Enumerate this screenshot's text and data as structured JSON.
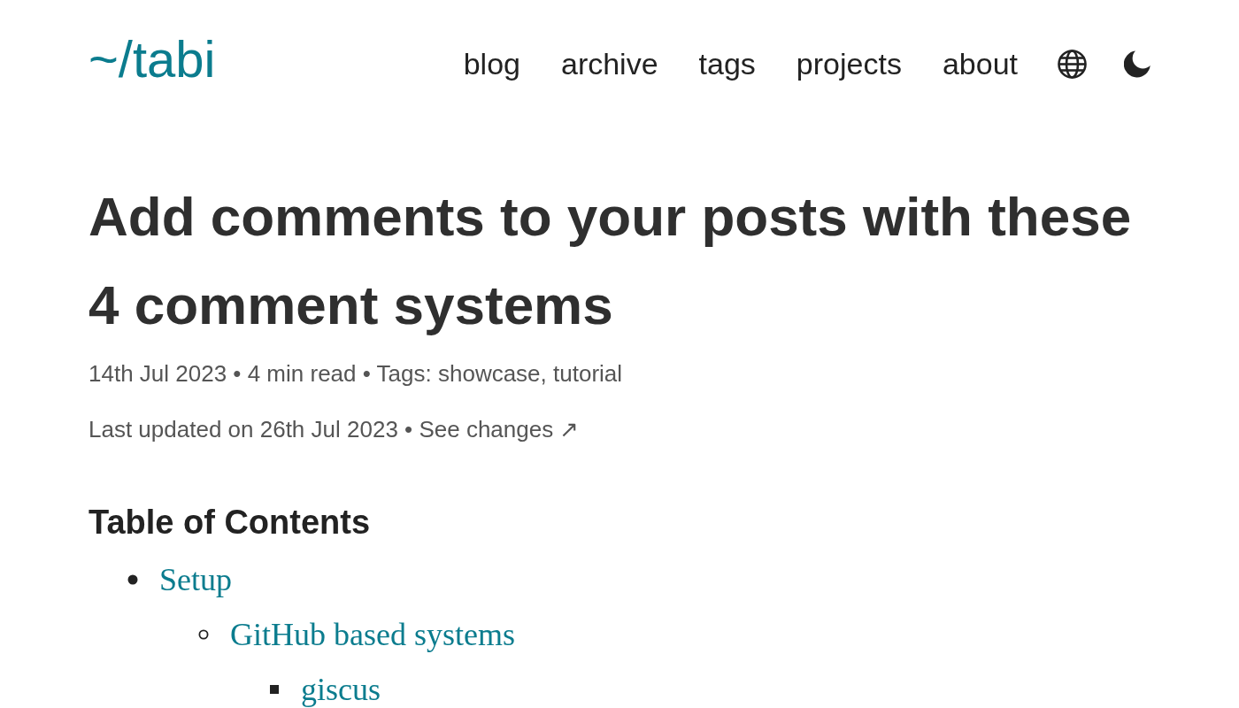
{
  "header": {
    "logo": "~/tabi",
    "nav": [
      "blog",
      "archive",
      "tags",
      "projects",
      "about"
    ]
  },
  "post": {
    "title": "Add comments to your posts with these 4 comment systems",
    "meta": "14th Jul 2023 • 4 min read • Tags: showcase, tutorial",
    "updated": {
      "text": "Last updated on 26th Jul 2023 •",
      "link": "See changes ↗"
    }
  },
  "toc": {
    "heading": "Table of Contents",
    "items": [
      {
        "label": "Setup",
        "children": [
          {
            "label": "GitHub based systems",
            "children": [
              {
                "label": "giscus"
              }
            ]
          }
        ]
      }
    ]
  }
}
